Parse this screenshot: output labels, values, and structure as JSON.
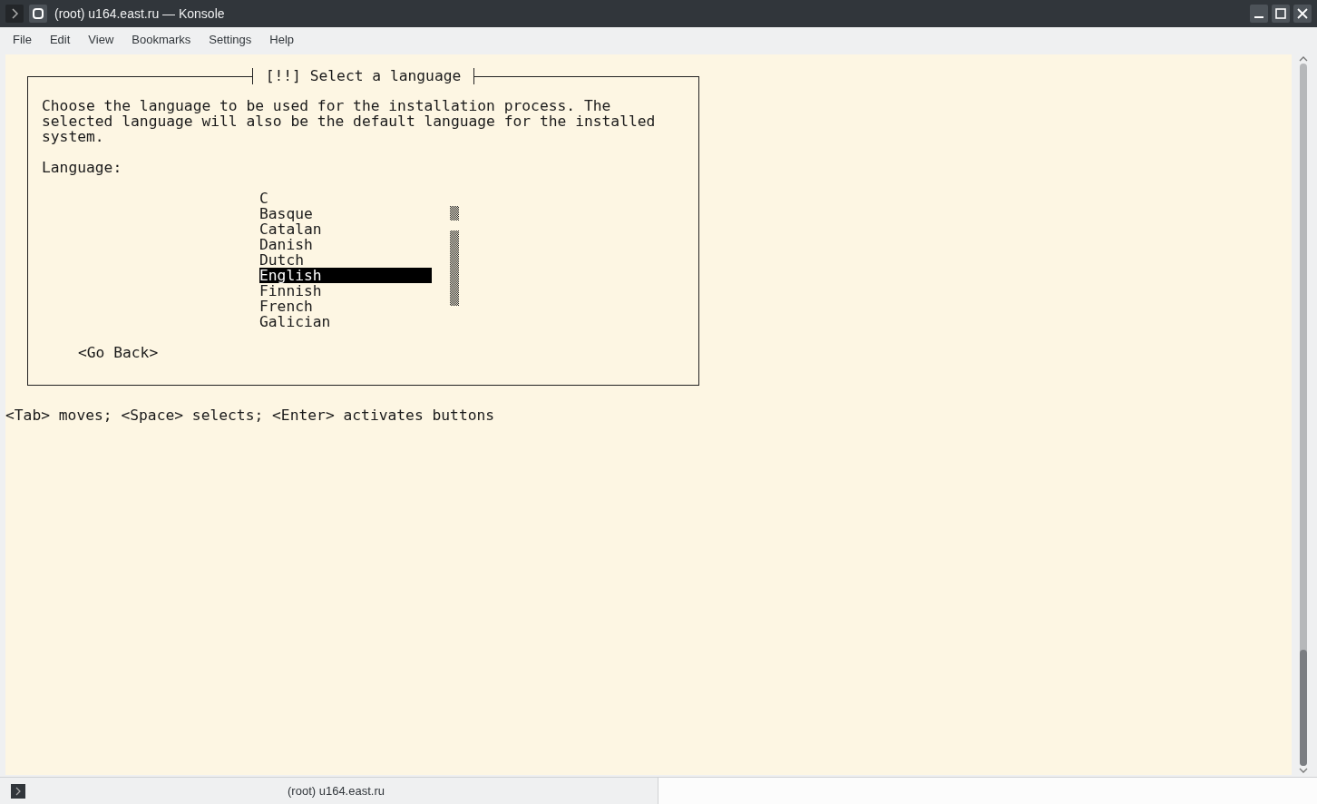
{
  "window": {
    "title": "(root) u164.east.ru — Konsole"
  },
  "menu": [
    "File",
    "Edit",
    "View",
    "Bookmarks",
    "Settings",
    "Help"
  ],
  "dialog": {
    "title": "[!!] Select a language",
    "description": "Choose the language to be used for the installation process. The\nselected language will also be the default language for the installed\nsystem.",
    "label": "Language:",
    "items": [
      {
        "label": "C",
        "selected": false
      },
      {
        "label": "Basque",
        "selected": false
      },
      {
        "label": "Catalan",
        "selected": false
      },
      {
        "label": "Danish",
        "selected": false
      },
      {
        "label": "Dutch",
        "selected": false
      },
      {
        "label": "English",
        "selected": true
      },
      {
        "label": "Finnish",
        "selected": false
      },
      {
        "label": "French",
        "selected": false
      },
      {
        "label": "Galician",
        "selected": false
      }
    ],
    "button": "<Go Back>"
  },
  "hint": "<Tab> moves; <Space> selects; <Enter> activates buttons",
  "status_bar": {
    "tab": "(root) u164.east.ru"
  }
}
